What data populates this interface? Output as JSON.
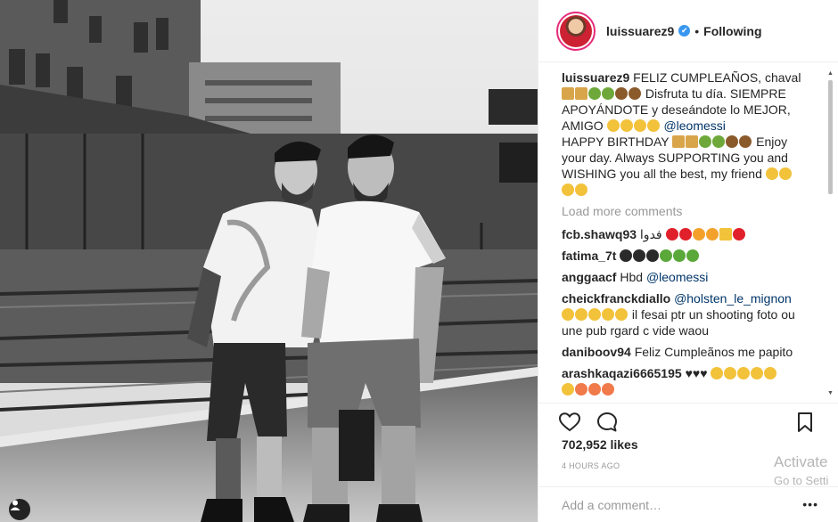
{
  "post": {
    "username": "luissuarez9",
    "follow_status": "Following",
    "separator": "•",
    "verified_mark": "✔",
    "caption_lines": {
      "l1": "FELIZ CUMPLEAÑOS, chaval",
      "l2a": "Disfruta tu día. SIEMPRE",
      "l3": "APOYÁNDOTE y deseándote lo MEJOR,",
      "l4a": "AMIGO",
      "mention": "@leomessi",
      "l5a": "HAPPY BIRTHDAY",
      "l5b": "Enjoy",
      "l6": "your day. Always SUPPORTING you and",
      "l7": "WISHING you all the best, my friend"
    },
    "load_more": "Load more comments",
    "comments": [
      {
        "user": "fcb.shawq93",
        "text": "فدوا"
      },
      {
        "user": "fatima_7t",
        "text": ""
      },
      {
        "user": "anggaacf",
        "text": "Hbd",
        "mention": "@leomessi"
      },
      {
        "user": "cheickfranckdiallo",
        "mention": "@holsten_le_mignon",
        "text": "il fesai ptr un shooting foto ou une pub rgard c vide waou"
      },
      {
        "user": "daniboov94",
        "text": "Feliz Cumpleãnos me papito"
      },
      {
        "user": "arashkaqazi6665195",
        "text": "♥♥♥"
      }
    ],
    "likes": "702,952 likes",
    "time": "4 HOURS AGO",
    "comment_placeholder": "Add a comment…",
    "more": "•••"
  },
  "icons": {
    "like": "heart-icon",
    "comment": "speech-bubble-icon",
    "save": "bookmark-icon",
    "tag": "person-tag-icon"
  },
  "colors": {
    "accent_link": "#003569",
    "verified": "#3897f0",
    "muted": "#999999",
    "story_ring": "#e62b7a"
  },
  "watermark": {
    "title": "Activate",
    "subtitle": "Go to Setti"
  }
}
